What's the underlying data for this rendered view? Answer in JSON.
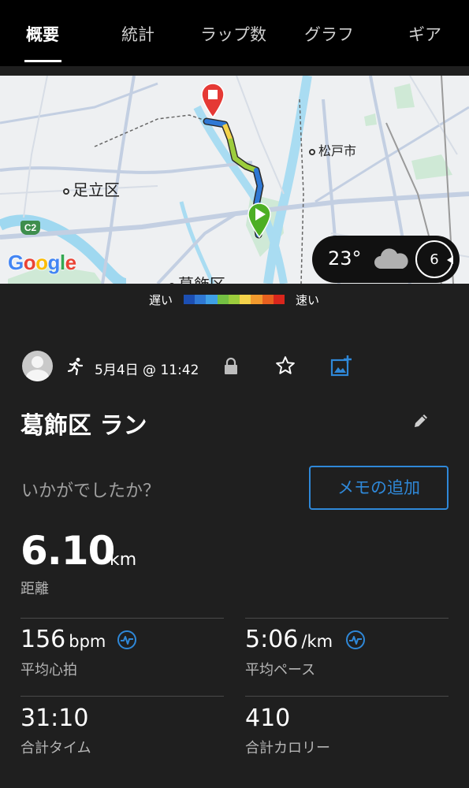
{
  "tabs": [
    {
      "label": "概要",
      "active": true
    },
    {
      "label": "統計",
      "active": false
    },
    {
      "label": "ラップ数",
      "active": false
    },
    {
      "label": "グラフ",
      "active": false
    },
    {
      "label": "ギア",
      "active": false
    }
  ],
  "map": {
    "labels": {
      "adachi": "足立区",
      "matsudo": "松戸市",
      "katsushika": "葛飾区"
    },
    "route_badge": "C2",
    "google_logo": "Google",
    "icons": [
      "stop-marker-icon",
      "start-marker-icon"
    ]
  },
  "weather": {
    "temperature": "23°",
    "condition_icon": "cloud-icon",
    "wind_speed": "6"
  },
  "speed_legend": {
    "slow_label": "遅い",
    "fast_label": "速い",
    "colors": [
      "#1c4fb3",
      "#2f78d4",
      "#3fa0e6",
      "#74c043",
      "#9ccd3d",
      "#f4d24a",
      "#f29a2e",
      "#e8601f",
      "#d9261c"
    ]
  },
  "activity": {
    "date": "5月4日 @ 11:42",
    "title": "葛飾区 ラン",
    "prompt": "いかがでしたか？",
    "memo_button": "メモの追加",
    "icons": [
      "avatar",
      "run-icon",
      "lock-icon",
      "star-icon",
      "add-photo-icon",
      "edit-icon"
    ]
  },
  "stats": {
    "distance": {
      "value": "6.10",
      "unit": "km",
      "label": "距離"
    },
    "heart_rate": {
      "value": "156",
      "unit": "bpm",
      "label": "平均心拍"
    },
    "pace": {
      "value": "5:06",
      "unit": "/km",
      "label": "平均ペース"
    },
    "time": {
      "value": "31:10",
      "label": "合計タイム"
    },
    "calories": {
      "value": "410",
      "label": "合計カロリー"
    }
  },
  "accent_color": "#2f88d8"
}
